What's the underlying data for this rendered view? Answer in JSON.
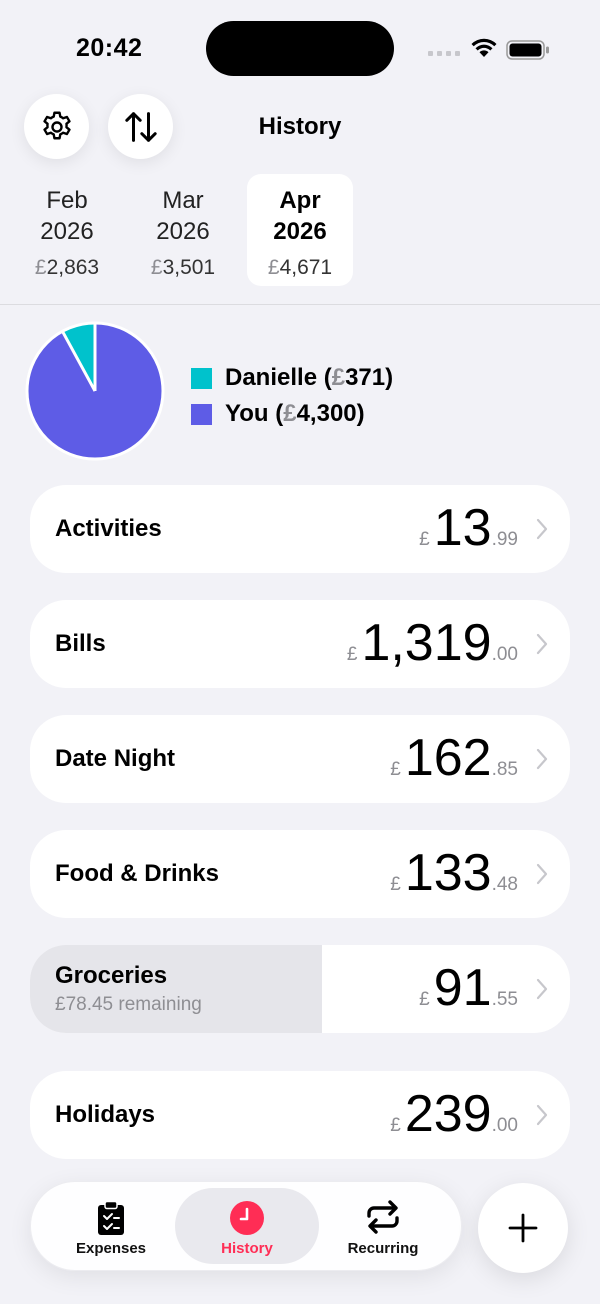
{
  "status": {
    "time": "20:42"
  },
  "header": {
    "title": "History",
    "settings_icon": "gear-icon",
    "sort_icon": "arrows-up-down-icon"
  },
  "months": [
    {
      "name": "Feb",
      "year": "2026",
      "currency": "£",
      "total": "2,863",
      "selected": false
    },
    {
      "name": "Mar",
      "year": "2026",
      "currency": "£",
      "total": "3,501",
      "selected": false
    },
    {
      "name": "Apr",
      "year": "2026",
      "currency": "£",
      "total": "4,671",
      "selected": true
    }
  ],
  "chart_data": {
    "type": "pie",
    "slices": [
      {
        "label": "Danielle",
        "value": 371,
        "color": "#00c2cc"
      },
      {
        "label": "You",
        "value": 4300,
        "color": "#5e5ce6"
      }
    ]
  },
  "legend": [
    {
      "name": "Danielle (",
      "currency": "£",
      "amount": "371)",
      "color": "#00c2cc"
    },
    {
      "name": "You (",
      "currency": "£",
      "amount": "4,300)",
      "color": "#5e5ce6"
    }
  ],
  "categories": [
    {
      "name": "Activities",
      "currency": "£",
      "int": "13",
      "dec": ".99",
      "sub": ""
    },
    {
      "name": "Bills",
      "currency": "£",
      "int": "1,319",
      "dec": ".00",
      "sub": ""
    },
    {
      "name": "Date Night",
      "currency": "£",
      "int": "162",
      "dec": ".85",
      "sub": ""
    },
    {
      "name": "Food & Drinks",
      "currency": "£",
      "int": "133",
      "dec": ".48",
      "sub": ""
    },
    {
      "name": "Groceries",
      "currency": "£",
      "int": "91",
      "dec": ".55",
      "sub": "£78.45 remaining",
      "budget_used_fraction": 0.54
    },
    {
      "name": "Holidays",
      "currency": "£",
      "int": "239",
      "dec": ".00",
      "sub": ""
    }
  ],
  "tabs": [
    {
      "label": "Expenses",
      "icon": "clipboard-check-icon",
      "active": false
    },
    {
      "label": "History",
      "icon": "clock-icon",
      "active": true
    },
    {
      "label": "Recurring",
      "icon": "repeat-icon",
      "active": false
    }
  ],
  "colors": {
    "accent": "#ff2d55",
    "danielle": "#00c2cc",
    "you": "#5e5ce6"
  },
  "fab_icon": "plus-icon"
}
